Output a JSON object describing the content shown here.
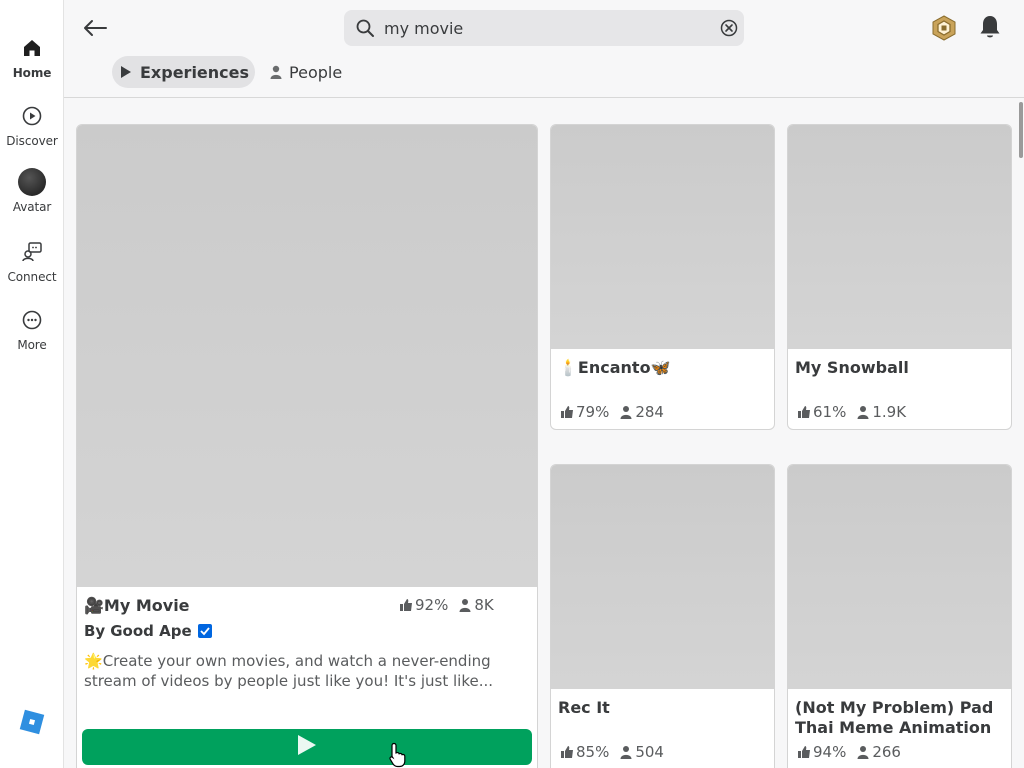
{
  "sidebar": {
    "items": [
      {
        "label": "Home",
        "icon": "home-icon"
      },
      {
        "label": "Discover",
        "icon": "discover-icon"
      },
      {
        "label": "Avatar",
        "icon": "avatar-icon"
      },
      {
        "label": "Connect",
        "icon": "connect-icon"
      },
      {
        "label": "More",
        "icon": "more-icon"
      }
    ],
    "logo": "roblox-logo-icon"
  },
  "header": {
    "search": {
      "value": "my movie",
      "placeholder": "Search"
    },
    "tabs": [
      {
        "label": "Experiences",
        "active": true
      },
      {
        "label": "People",
        "active": false
      }
    ]
  },
  "featured": {
    "title_emoji": "🎥",
    "title": "My Movie",
    "rating": "92%",
    "players": "8K",
    "by_label": "By",
    "creator": "Good Ape",
    "desc_emoji": "🌟",
    "description": "Create your own movies, and watch a never-ending stream of videos by people just like you! It's just like..."
  },
  "cards": [
    {
      "title_prefix": "🕯️",
      "title": "Encanto",
      "title_suffix": "🦋",
      "rating": "79%",
      "players": "284"
    },
    {
      "title_prefix": "",
      "title": "My Snowball",
      "title_suffix": "",
      "rating": "61%",
      "players": "1.9K"
    },
    {
      "title_prefix": "",
      "title": "Rec It",
      "title_suffix": "",
      "rating": "85%",
      "players": "504"
    },
    {
      "title_prefix": "",
      "title": "(Not My Problem) Pad Thai Meme Animation",
      "title_suffix": "",
      "rating": "94%",
      "players": "266"
    }
  ],
  "colors": {
    "play_button": "#00a15d",
    "verified": "#0066e0",
    "accent_text": "#393b3d"
  }
}
